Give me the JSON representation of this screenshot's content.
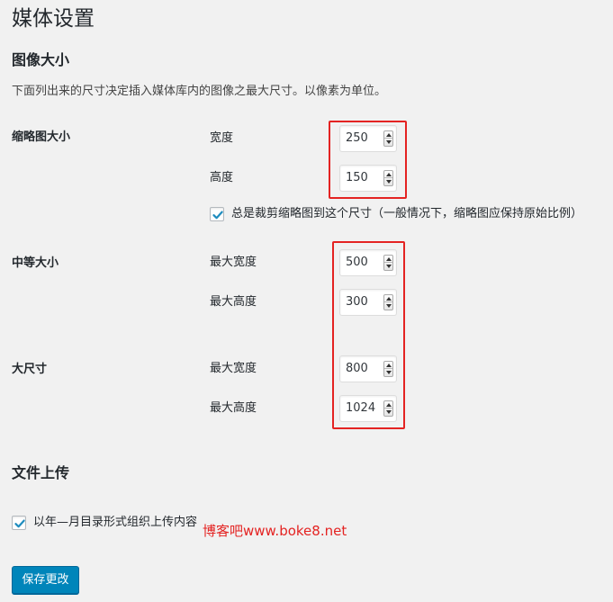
{
  "page_title": "媒体设置",
  "image_sizes": {
    "title": "图像大小",
    "description": "下面列出来的尺寸决定插入媒体库内的图像之最大尺寸。以像素为单位。",
    "thumbnail": {
      "label": "缩略图大小",
      "width_label": "宽度",
      "width": "250",
      "height_label": "高度",
      "height": "150",
      "crop_label": "总是裁剪缩略图到这个尺寸（一般情况下，缩略图应保持原始比例）",
      "crop_checked": true
    },
    "medium": {
      "label": "中等大小",
      "max_width_label": "最大宽度",
      "max_width": "500",
      "max_height_label": "最大高度",
      "max_height": "300"
    },
    "large": {
      "label": "大尺寸",
      "max_width_label": "最大宽度",
      "max_width": "800",
      "max_height_label": "最大高度",
      "max_height": "1024"
    }
  },
  "uploads": {
    "title": "文件上传",
    "organize_label": "以年—月目录形式组织上传内容",
    "organize_checked": true
  },
  "save_button": "保存更改",
  "watermark": "博客吧www.boke8.net",
  "colors": {
    "accent": "#0085ba",
    "checkmark": "#1e8cbe",
    "highlight": "#e42322"
  }
}
